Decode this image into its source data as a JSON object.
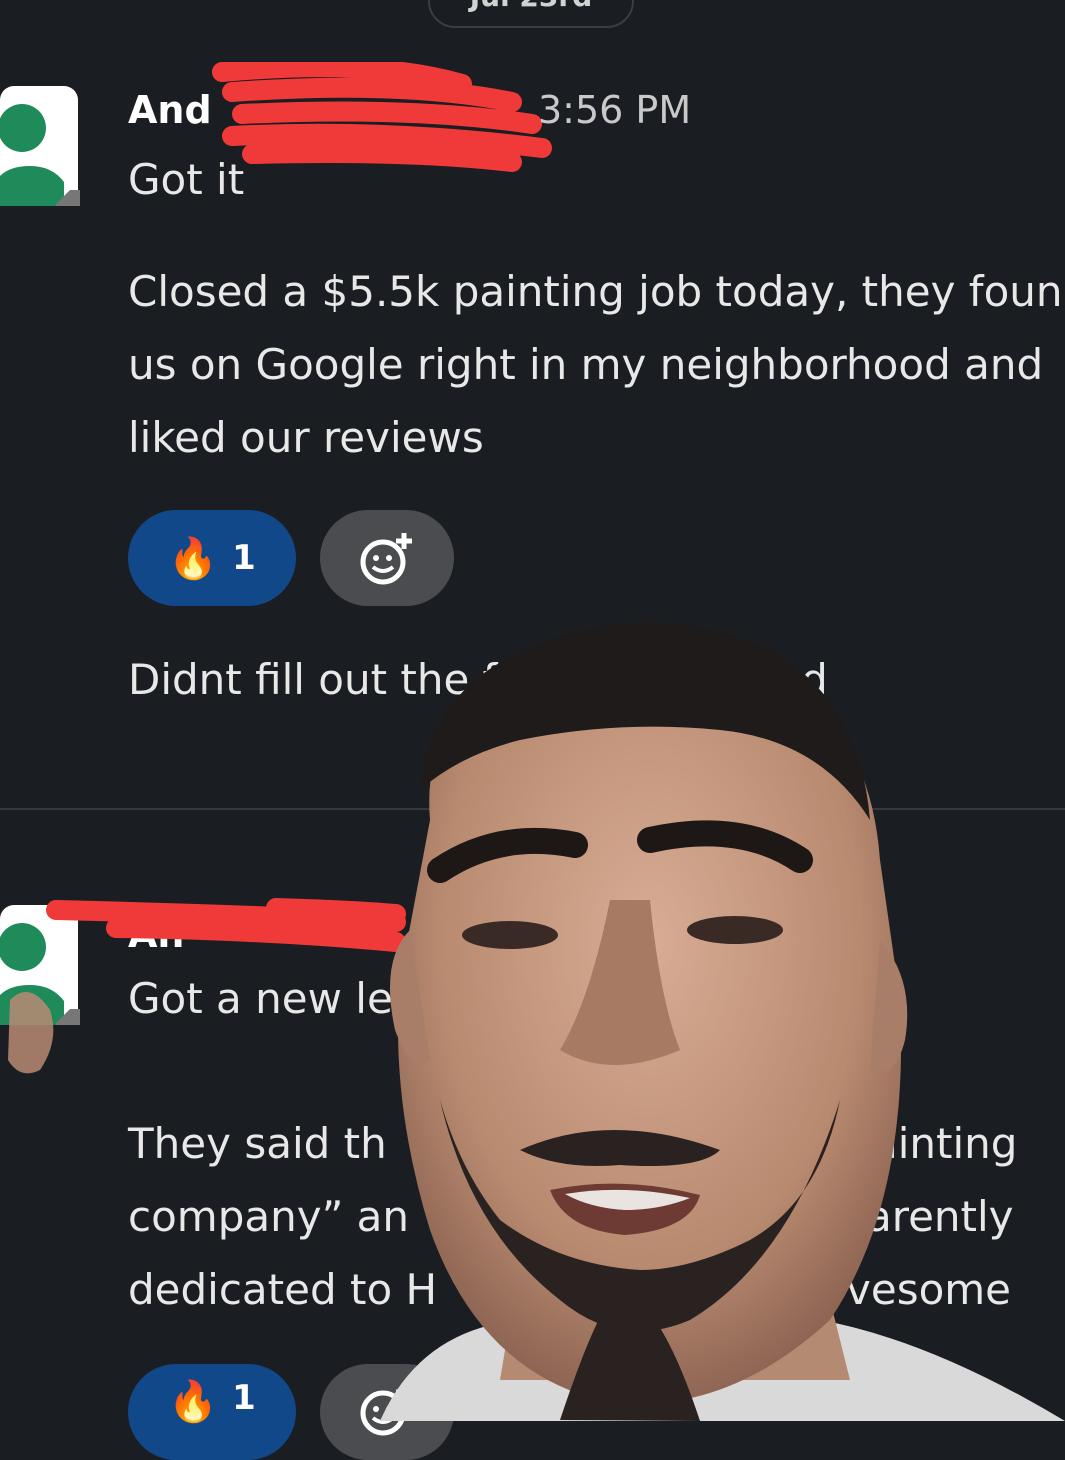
{
  "date_separator": "Jul 23rd",
  "messages": [
    {
      "sender": "And",
      "time": "3:56 PM",
      "lines": [
        "Got it",
        "Closed a $5.5k painting job today, they foun",
        "us on Google right in my neighborhood and",
        "liked our reviews",
        "Didnt fill out the f",
        "lled"
      ],
      "reaction": {
        "emoji": "🔥",
        "count": "1"
      }
    },
    {
      "sender": "An",
      "lines": [
        "Got a new le",
        "They said th",
        "ainting",
        "company” an",
        "arently",
        "dedicated to H",
        "vesome"
      ],
      "reaction": {
        "emoji": "🔥",
        "count": "1"
      }
    }
  ],
  "colors": {
    "background": "#1a1d21",
    "reaction_active": "#11488a",
    "reaction_add": "#4b4c4f",
    "avatar_green": "#1f8a5a",
    "redaction": "#f03a3a"
  },
  "icons": {
    "add_reaction": "add-emoji-icon",
    "avatar": "user-avatar-icon"
  }
}
